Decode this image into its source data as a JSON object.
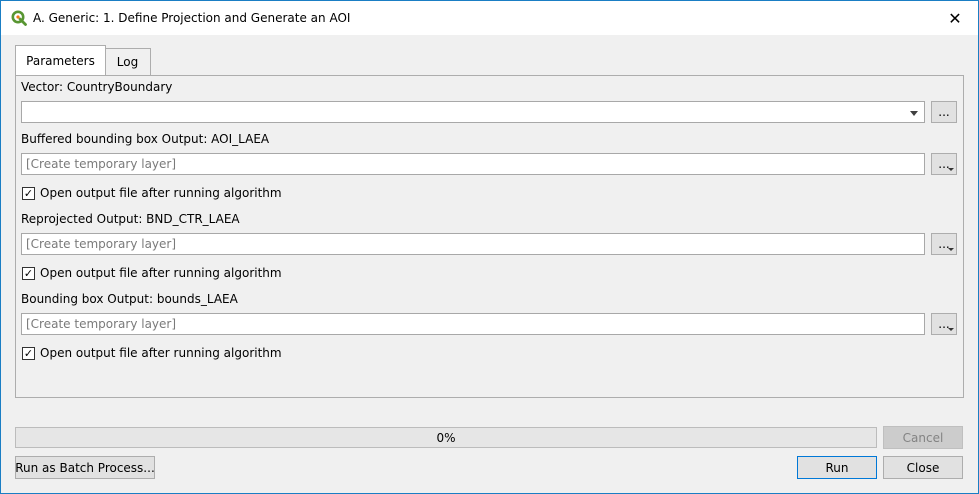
{
  "window": {
    "title": "A. Generic: 1. Define Projection and Generate an AOI",
    "close_glyph": "✕"
  },
  "tabs": [
    {
      "label": "Parameters",
      "active": true
    },
    {
      "label": "Log",
      "active": false
    }
  ],
  "parameters": {
    "vector_label": "Vector: CountryBoundary",
    "vector_value": "",
    "browse_label": "...",
    "outputs": [
      {
        "label": "Buffered bounding box Output: AOI_LAEA",
        "placeholder": "[Create temporary layer]",
        "open_after_label": "Open output file after running algorithm",
        "open_after_checked": true
      },
      {
        "label": "Reprojected Output: BND_CTR_LAEA",
        "placeholder": "[Create temporary layer]",
        "open_after_label": "Open output file after running algorithm",
        "open_after_checked": true
      },
      {
        "label": "Bounding box Output:  bounds_LAEA",
        "placeholder": "[Create temporary layer]",
        "open_after_label": "Open output file after running algorithm",
        "open_after_checked": true
      }
    ],
    "check_glyph": "✓"
  },
  "progress": {
    "text": "0%",
    "value": 0
  },
  "buttons": {
    "cancel": "Cancel",
    "batch": "Run as Batch Process...",
    "run": "Run",
    "close": "Close"
  },
  "colors": {
    "accent": "#0078d7",
    "qgis_green": "#589632",
    "qgis_yellow": "#ee7913"
  }
}
